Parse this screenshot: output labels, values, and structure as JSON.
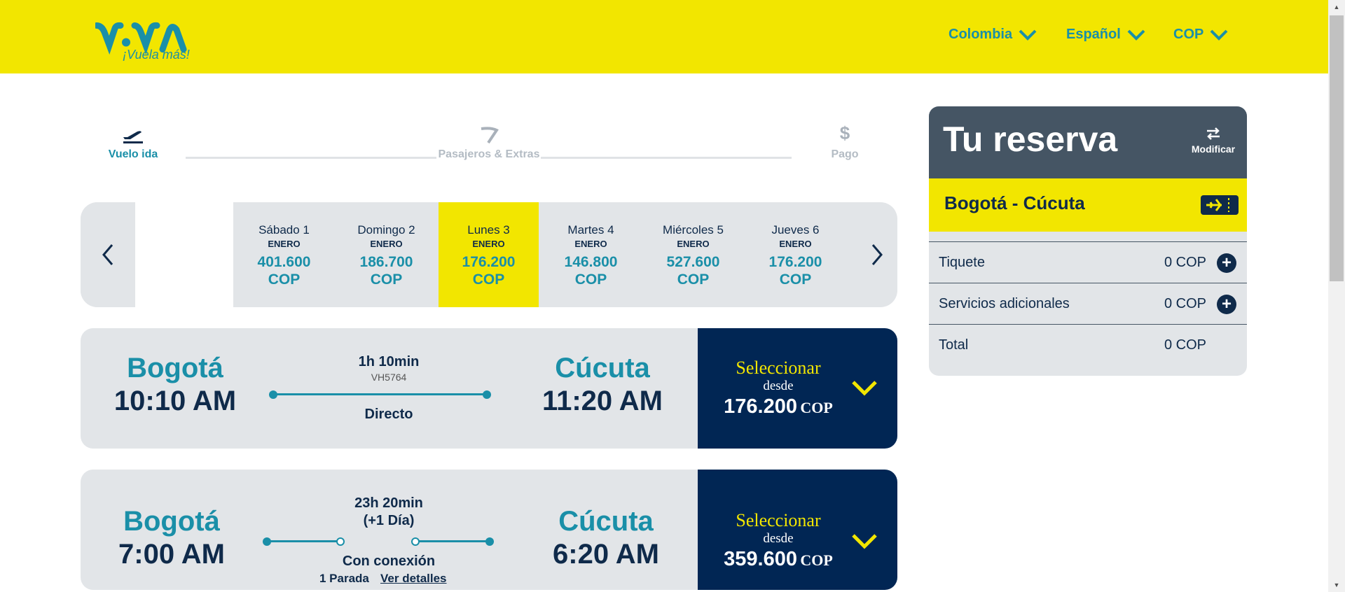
{
  "header": {
    "logo_text": "VIVA",
    "tagline": "¡Vuela más!",
    "country": "Colombia",
    "language": "Español",
    "currency": "COP"
  },
  "steps": [
    {
      "label": "Vuelo ida",
      "active": true
    },
    {
      "label": "Pasajeros & Extras",
      "active": false
    },
    {
      "label": "Pago",
      "active": false
    }
  ],
  "dates": [
    {
      "day": "Sábado 1",
      "month": "ENERO",
      "price": "401.600",
      "currency": "COP"
    },
    {
      "day": "Domingo 2",
      "month": "ENERO",
      "price": "186.700",
      "currency": "COP"
    },
    {
      "day": "Lunes 3",
      "month": "ENERO",
      "price": "176.200",
      "currency": "COP",
      "selected": true
    },
    {
      "day": "Martes 4",
      "month": "ENERO",
      "price": "146.800",
      "currency": "COP"
    },
    {
      "day": "Miércoles 5",
      "month": "ENERO",
      "price": "527.600",
      "currency": "COP"
    },
    {
      "day": "Jueves 6",
      "month": "ENERO",
      "price": "176.200",
      "currency": "COP"
    }
  ],
  "flights": [
    {
      "origin": "Bogotá",
      "depart": "10:10 AM",
      "destination": "Cúcuta",
      "arrive": "11:20 AM",
      "duration": "1h 10min",
      "code": "VH5764",
      "type": "Directo",
      "select_label": "Seleccionar",
      "desde": "desde",
      "price": "176.200",
      "currency": "COP"
    },
    {
      "origin": "Bogotá",
      "depart": "7:00 AM",
      "destination": "Cúcuta",
      "arrive": "6:20 AM",
      "duration": "23h 20min",
      "extra_day": "(+1 Día)",
      "type": "Con conexión",
      "stops": "1 Parada",
      "details_link": "Ver detalles",
      "select_label": "Seleccionar",
      "desde": "desde",
      "price": "359.600",
      "currency": "COP"
    }
  ],
  "reservation": {
    "title": "Tu reserva",
    "modify": "Modificar",
    "route": "Bogotá - Cúcuta",
    "rows": [
      {
        "label": "Tiquete",
        "value": "0 COP"
      },
      {
        "label": "Servicios adicionales",
        "value": "0 COP"
      },
      {
        "label": "Total",
        "value": "0 COP"
      }
    ]
  },
  "colors": {
    "brand_yellow": "#f2e600",
    "brand_teal": "#1a8fa8",
    "navy": "#012654",
    "panel_gray": "#e2e5e8",
    "slate": "#455564"
  }
}
